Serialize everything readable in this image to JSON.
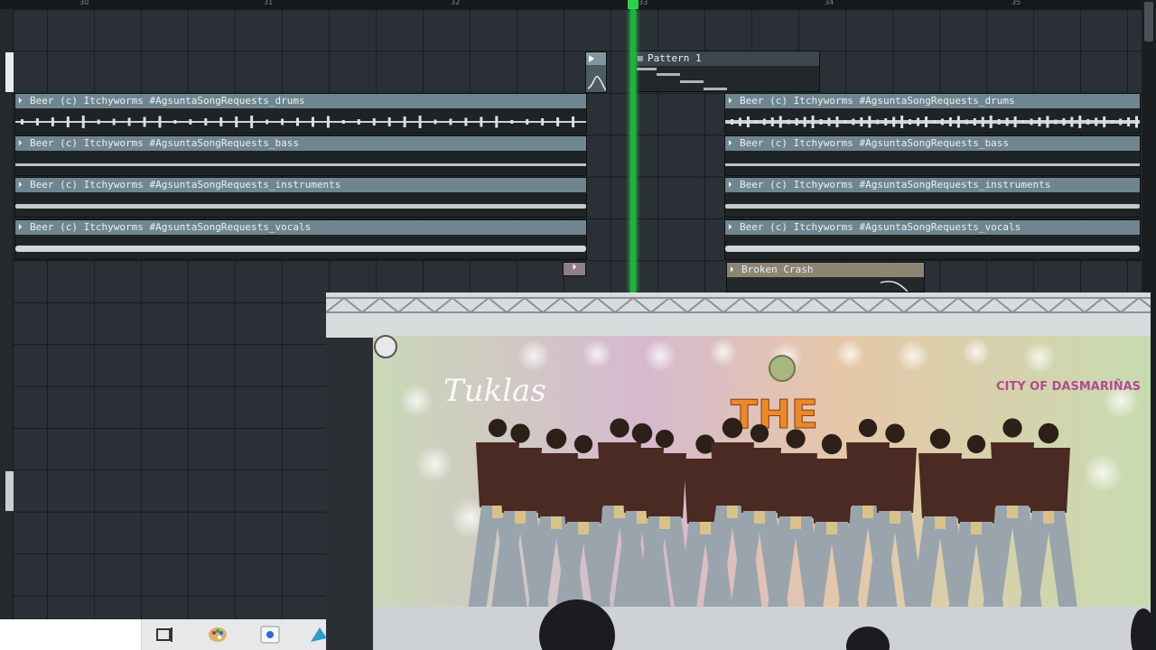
{
  "ruler": {
    "ticks": [
      "30",
      "31",
      "32",
      "33",
      "34",
      "35"
    ]
  },
  "colors": {
    "playhead": "#1fb33a",
    "audio_clip_header": "#6f8690",
    "pattern_clip_header": "#3d474d",
    "crash_clip_header": "#8d8573",
    "grid_background": "#2a3035"
  },
  "tracks": {
    "pattern": {
      "name": "Pattern 1"
    },
    "audio_left": [
      {
        "name": "Beer (c) Itchyworms #AgsuntaSongRequests_drums"
      },
      {
        "name": "Beer (c) Itchyworms #AgsuntaSongRequests_bass"
      },
      {
        "name": "Beer (c) Itchyworms #AgsuntaSongRequests_instruments"
      },
      {
        "name": "Beer (c) Itchyworms #AgsuntaSongRequests_vocals"
      }
    ],
    "audio_right": [
      {
        "name": "Beer (c) Itchyworms #AgsuntaSongRequests_drums"
      },
      {
        "name": "Beer (c) Itchyworms #AgsuntaSongRequests_bass"
      },
      {
        "name": "Beer (c) Itchyworms #AgsuntaSongRequests_instruments"
      },
      {
        "name": "Beer (c) Itchyworms #AgsuntaSongRequests_vocals"
      }
    ],
    "crash": {
      "name": "Broken Crash"
    }
  },
  "video": {
    "banner_left": "Tuklas",
    "banner_center": "THE",
    "banner_right": "CITY OF DASMARIÑAS"
  },
  "taskbar": {
    "icons": [
      "task-view-icon",
      "paint-palette-icon",
      "app-window-icon",
      "browser-icon"
    ]
  }
}
